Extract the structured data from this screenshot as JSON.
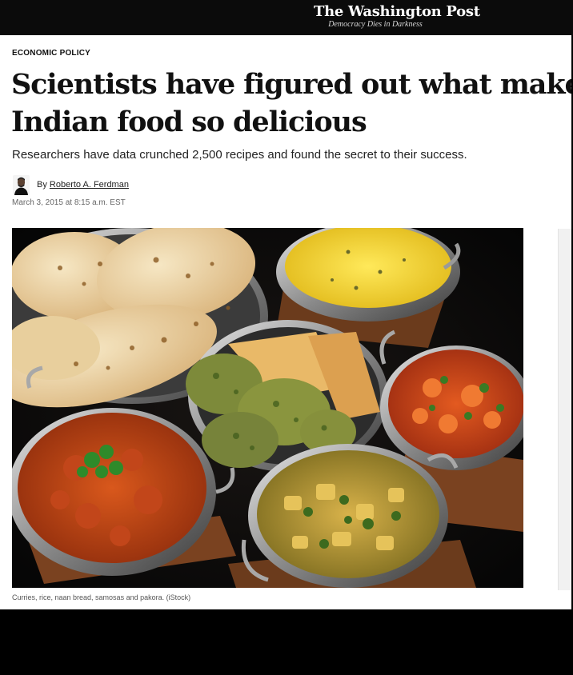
{
  "masthead": {
    "logo": "The Washington Post",
    "tagline": "Democracy Dies in Darkness"
  },
  "article": {
    "kicker": "ECONOMIC POLICY",
    "headline_line1": "Scientists have figured out what makes",
    "headline_line2": "Indian food so delicious",
    "dek": "Researchers have data crunched 2,500 recipes and found the secret to their success.",
    "byline_prefix": "By",
    "author": "Roberto A. Ferdman",
    "date": "March 3, 2015 at 8:15 a.m. EST",
    "caption": "Curries, rice, naan bread, samosas and pakora. (iStock)"
  },
  "colors": {
    "background": "#000000",
    "article_background": "#ffffff",
    "text": "#111111",
    "meta": "#666666"
  }
}
